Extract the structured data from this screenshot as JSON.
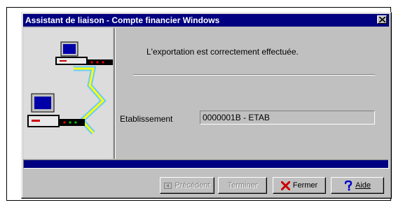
{
  "window": {
    "title": "Assistant de liaison - Compte financier Windows",
    "close_glyph": "✕"
  },
  "main": {
    "message": "L'exportation est correctement effectuée.",
    "field_label": "Etablissement",
    "field_value": "0000001B - ETAB"
  },
  "buttons": {
    "precedent": "Précédent",
    "terminer": "Terminer",
    "fermer": "Fermer",
    "aide": "Aide"
  },
  "icons": {
    "precedent": "previous-arrow-icon",
    "fermer": "close-x-icon",
    "aide": "help-question-icon"
  },
  "colors": {
    "titlebar": "#000080",
    "dialog_face": "#c0c0c0",
    "progress": "#000080",
    "fermer_icon": "#cc0000",
    "aide_icon": "#0000cc"
  }
}
